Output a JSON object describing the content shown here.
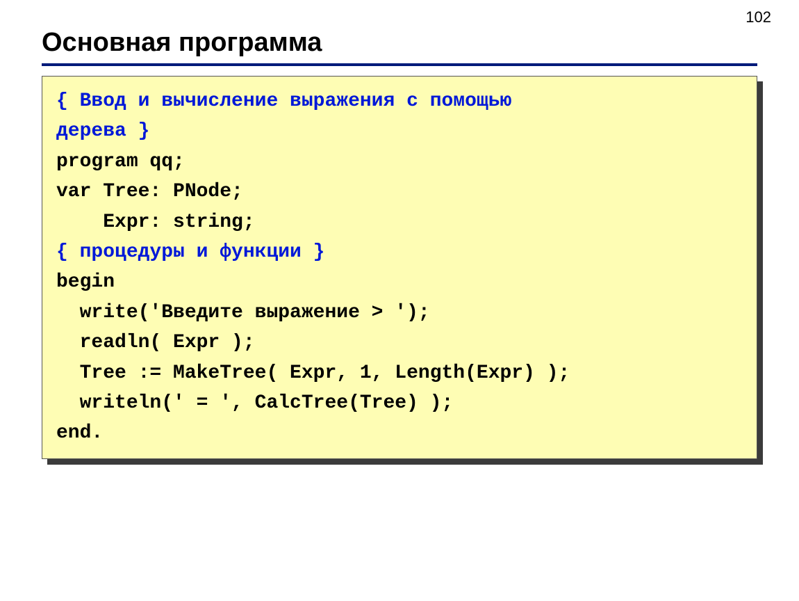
{
  "pageNumber": "102",
  "title": "Основная программа",
  "code": {
    "comment1a": "{ Ввод и вычисление выражения с помощью",
    "comment1b": "дерева }",
    "line3": "program qq;",
    "line4": "var Tree: PNode;",
    "line5": "    Expr: string;",
    "comment2": "{ процедуры и функции }",
    "line7": "begin",
    "line8": "  write('Введите выражение > ');",
    "line9": "  readln( Expr );",
    "line10": "  Tree := MakeTree( Expr, 1, Length(Expr) );",
    "line11": "  writeln(' = ', CalcTree(Tree) );",
    "line12": "end."
  }
}
